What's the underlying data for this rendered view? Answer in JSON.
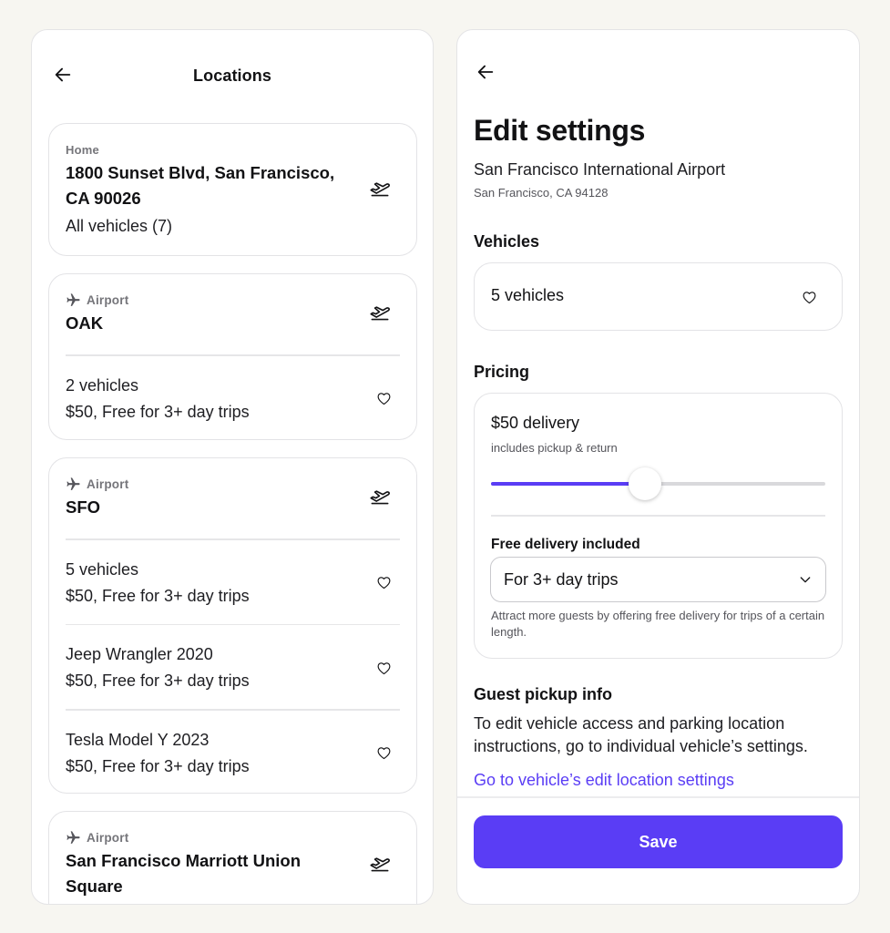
{
  "left": {
    "title": "Locations",
    "cards": [
      {
        "tag": "Home",
        "name_line1": "1800 Sunset Blvd, San Francisco,",
        "name_line2": "CA 90026",
        "summary": "All vehicles (7)"
      },
      {
        "tag": "Airport",
        "name": "OAK",
        "rows": [
          {
            "l1": "2 vehicles",
            "l2": "$50, Free for 3+ day trips"
          }
        ]
      },
      {
        "tag": "Airport",
        "name": "SFO",
        "rows": [
          {
            "l1": "5 vehicles",
            "l2": "$50, Free for 3+ day trips"
          },
          {
            "l1": "Jeep Wrangler 2020",
            "l2": "$50, Free for 3+ day trips"
          },
          {
            "l1": "Tesla Model Y 2023",
            "l2": "$50, Free for 3+ day trips"
          }
        ]
      },
      {
        "tag": "Airport",
        "name_line1": "San Francisco Marriott Union",
        "name_line2": "Square"
      }
    ]
  },
  "right": {
    "title": "Edit settings",
    "location_name": "San Francisco International Airport",
    "location_address": "San Francisco, CA 94128",
    "vehicles_heading": "Vehicles",
    "vehicles_value": "5 vehicles",
    "pricing_heading": "Pricing",
    "delivery_price": "$50 delivery",
    "delivery_note": "includes pickup & return",
    "delivery_slider_level": 0.46,
    "free_delivery_label": "Free delivery included",
    "free_delivery_value": "For 3+ day trips",
    "free_delivery_helper": "Attract more guests by offering free delivery for trips of a certain length.",
    "pickup_heading": "Guest pickup info",
    "pickup_text": "To edit vehicle access and parking location instructions, go to individual vehicle’s settings.",
    "pickup_link": "Go to vehicle’s edit location settings",
    "save_label": "Save"
  },
  "colors": {
    "accent": "#5a3df5",
    "background": "#f7f6f1"
  }
}
